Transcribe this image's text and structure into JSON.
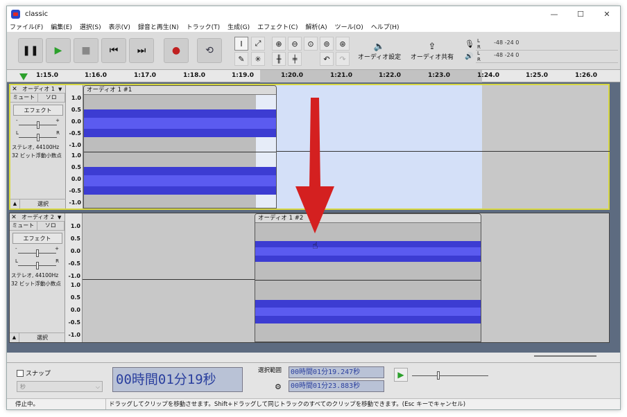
{
  "window": {
    "title": "classic",
    "minimize": "—",
    "maximize": "☐",
    "close": "✕"
  },
  "menu": [
    "ファイル(F)",
    "編集(E)",
    "選択(S)",
    "表示(V)",
    "録音と再生(N)",
    "トラック(T)",
    "生成(G)",
    "エフェクト(C)",
    "解析(A)",
    "ツール(O)",
    "ヘルプ(H)"
  ],
  "toolbar": {
    "audio_setup": "オーディオ設定",
    "share_audio": "オーディオ共有"
  },
  "meter": {
    "rec_scale": "-48    -24    0",
    "play_scale": "-48    -24    0",
    "left": "L",
    "right": "R"
  },
  "ruler": {
    "ticks": [
      "1:15.0",
      "1:16.0",
      "1:17.0",
      "1:18.0",
      "1:19.0",
      "1:20.0",
      "1:21.0",
      "1:22.0",
      "1:23.0",
      "1:24.0",
      "1:25.0",
      "1:26.0"
    ]
  },
  "tracks": [
    {
      "name": "オーディオ 1",
      "mute": "ミュート",
      "solo": "ソロ",
      "effects": "エフェクト",
      "gain_minus": "-",
      "gain_plus": "+",
      "pan_l": "L",
      "pan_r": "R",
      "info1": "ステレオ, 44100Hz",
      "info2": "32 ビット浮動小数点",
      "select": "選択",
      "clip_label": "オーディオ 1 #1",
      "scale": [
        "1.0",
        "0.5",
        "0.0",
        "-0.5",
        "-1.0",
        "1.0",
        "0.5",
        "0.0",
        "-0.5",
        "-1.0"
      ]
    },
    {
      "name": "オーディオ 2",
      "mute": "ミュート",
      "solo": "ソロ",
      "effects": "エフェクト",
      "gain_minus": "-",
      "gain_plus": "+",
      "pan_l": "L",
      "pan_r": "R",
      "info1": "ステレオ, 44100Hz",
      "info2": "32 ビット浮動小数点",
      "select": "選択",
      "clip_label": "オーディオ 1 #2",
      "scale": [
        "1.0",
        "0.5",
        "0.0",
        "-0.5",
        "-1.0",
        "1.0",
        "0.5",
        "0.0",
        "-0.5",
        "-1.0"
      ]
    }
  ],
  "bottom": {
    "snap_label": "スナップ",
    "snap_unit": "秒",
    "time_display": "00時間01分19秒",
    "selection_label": "選択範囲",
    "sel_start": "00時間01分19.247秒",
    "sel_end": "00時間01分23.883秒"
  },
  "status": {
    "state": "停止中。",
    "message": "ドラッグしてクリップを移動させます。Shift+ドラッグして同じトラックのすべてのクリップを移動できます。(Esc キーでキャンセル)"
  },
  "colors": {
    "wave": "#3c3cd2",
    "arrow": "#d42020",
    "selection": "#d4e0f8"
  }
}
